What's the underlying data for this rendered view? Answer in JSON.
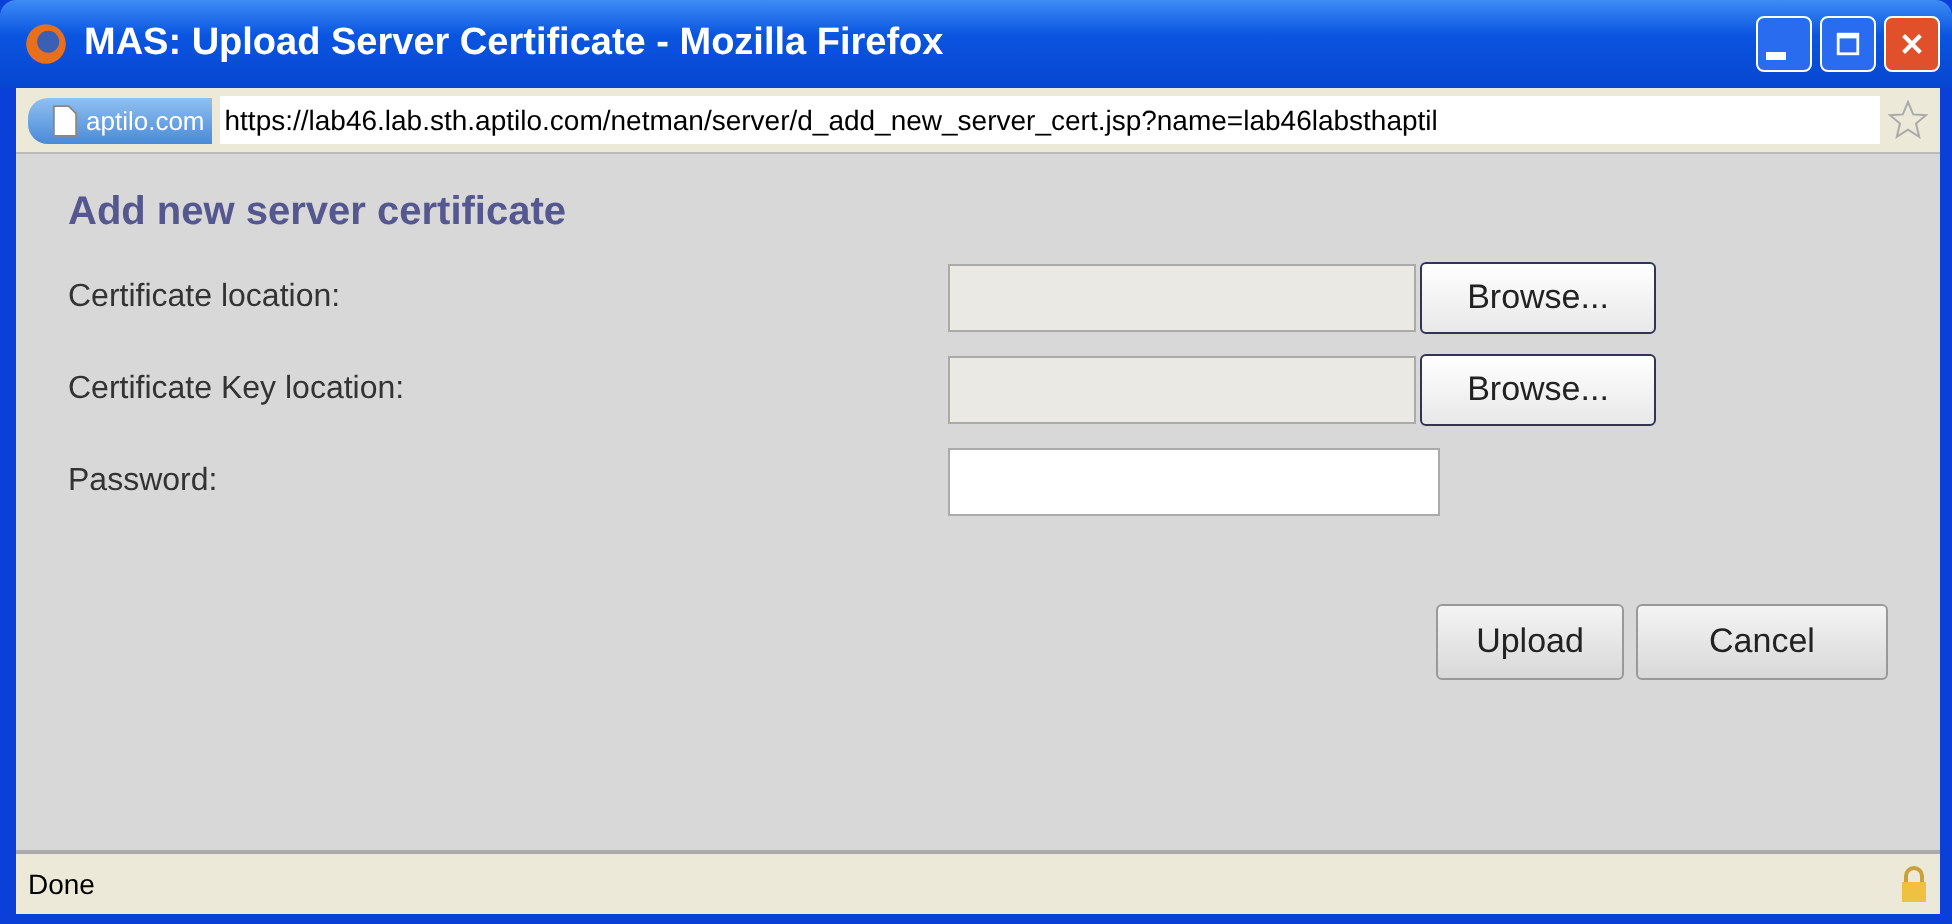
{
  "window": {
    "title": "MAS: Upload Server Certificate - Mozilla Firefox"
  },
  "address_bar": {
    "site_badge": "aptilo.com",
    "url": "https://lab46.lab.sth.aptilo.com/netman/server/d_add_new_server_cert.jsp?name=lab46labsthaptil"
  },
  "heading": "Add new server certificate",
  "fields": [
    {
      "label": "Certificate location:",
      "kind": "file",
      "button": "Browse..."
    },
    {
      "label": "Certificate Key location:",
      "kind": "file",
      "button": "Browse..."
    },
    {
      "label": "Password:",
      "kind": "password"
    }
  ],
  "buttons": [
    "Upload",
    "Cancel"
  ],
  "status_bar": {
    "text": "Done"
  }
}
